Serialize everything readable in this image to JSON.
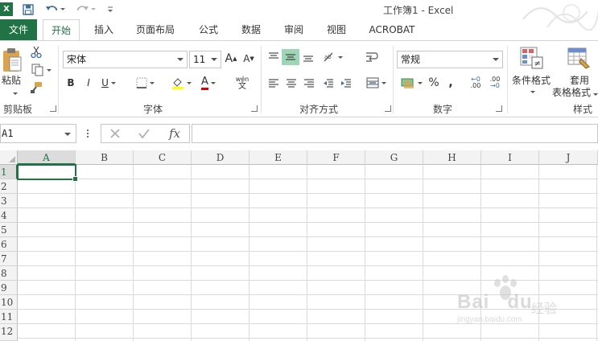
{
  "window": {
    "title": "工作簿1 - Excel",
    "logo_text": "X"
  },
  "quick_access": {
    "save_icon": "save-icon",
    "undo_icon": "undo-icon",
    "redo_icon": "redo-icon",
    "customize_icon": "customize-icon"
  },
  "tabs": [
    {
      "label": "文件"
    },
    {
      "label": "开始"
    },
    {
      "label": "插入"
    },
    {
      "label": "页面布局"
    },
    {
      "label": "公式"
    },
    {
      "label": "数据"
    },
    {
      "label": "审阅"
    },
    {
      "label": "视图"
    },
    {
      "label": "ACROBAT"
    }
  ],
  "ribbon": {
    "clipboard": {
      "paste_label": "粘贴",
      "group_label": "剪贴板"
    },
    "font": {
      "font_name": "宋体",
      "font_size": "11",
      "bold": "B",
      "italic": "I",
      "underline": "U",
      "phonetic": "wén",
      "phonetic_char": "文",
      "grow": "A",
      "shrink": "A",
      "font_color_letter": "A",
      "group_label": "字体"
    },
    "alignment": {
      "group_label": "对齐方式"
    },
    "number": {
      "format": "常规",
      "percent": "%",
      "comma": ",",
      "inc_decimal": ".00",
      "dec_decimal": ".00",
      "group_label": "数字"
    },
    "styles": {
      "conditional_format": "条件格式",
      "table_format_line1": "套用",
      "table_format_line2": "表格格式",
      "group_label": "样式"
    }
  },
  "formula_bar": {
    "name_box": "A1",
    "fx": "fx",
    "formula": ""
  },
  "grid": {
    "columns": [
      "A",
      "B",
      "C",
      "D",
      "E",
      "F",
      "G",
      "H",
      "I",
      "J"
    ],
    "rows": [
      "1",
      "2",
      "3",
      "4",
      "5",
      "6",
      "7",
      "8",
      "9",
      "10",
      "11",
      "12"
    ],
    "active_cell": "A1"
  },
  "watermark": {
    "brand": "Bai",
    "brand_end": "du",
    "slogan": "经验",
    "url": "jingyan.baidu.com"
  },
  "colors": {
    "accent": "#217346",
    "highlight": "#9fd5b7"
  }
}
